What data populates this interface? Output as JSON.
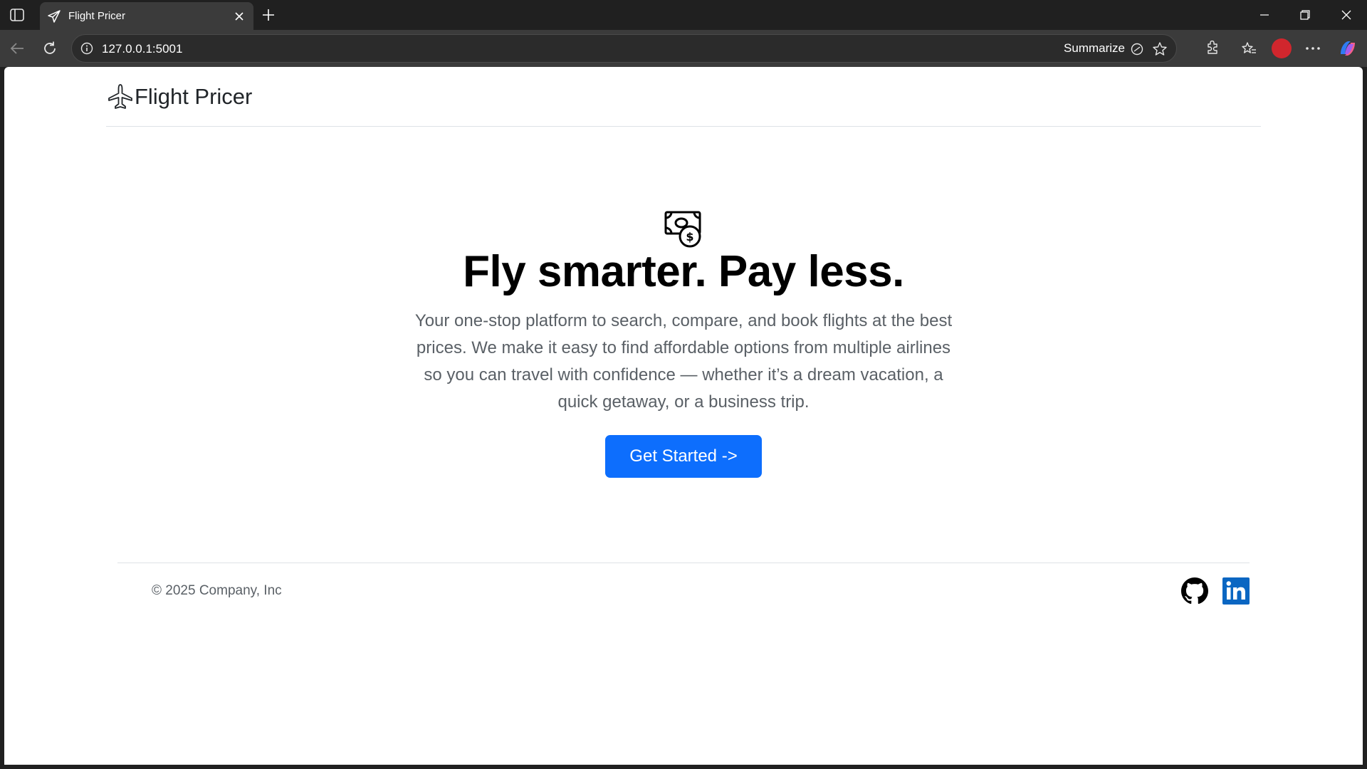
{
  "browser": {
    "tab_title": "Flight Pricer",
    "url": "127.0.0.1:5001",
    "summarize_label": "Summarize",
    "icons": [
      "sidebar-toggle-icon",
      "paper-plane-icon",
      "close-icon",
      "plus-icon",
      "minimize-icon",
      "restore-icon",
      "close-window-icon",
      "back-icon",
      "refresh-icon",
      "info-icon",
      "summarize-icon",
      "star-icon",
      "extensions-icon",
      "favorites-icon",
      "more-icon",
      "copilot-icon"
    ]
  },
  "site": {
    "brand": "Flight Pricer",
    "hero_title": "Fly smarter. Pay less.",
    "hero_lead": "Your one-stop platform to search, compare, and book flights at the best prices. We make it easy to find affordable options from multiple airlines so you can travel with confidence — whether it’s a dream vacation, a quick getaway, or a business trip.",
    "cta_label": "Get Started ->",
    "copyright": "© 2025 Company, Inc",
    "colors": {
      "primary": "#0d6efd",
      "linkedin": "#0a66c2",
      "text": "#212529",
      "muted": "#5a6066"
    }
  }
}
